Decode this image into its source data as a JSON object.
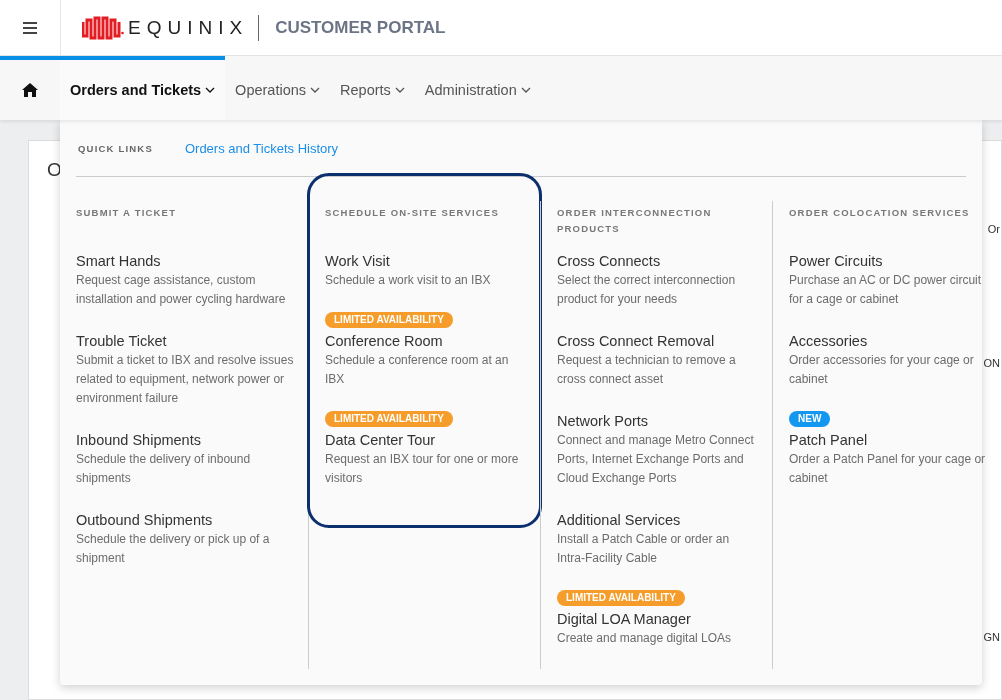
{
  "header": {
    "logo_text": "EQUINIX",
    "portal_title": "CUSTOMER PORTAL"
  },
  "nav": {
    "tabs": [
      {
        "label": "Orders and Tickets",
        "selected": true
      },
      {
        "label": "Operations",
        "selected": false
      },
      {
        "label": "Reports",
        "selected": false
      },
      {
        "label": "Administration",
        "selected": false
      }
    ]
  },
  "background": {
    "card_title": "O",
    "fragments": [
      "Or",
      "ON",
      "GN"
    ]
  },
  "menu": {
    "quick_links_label": "QUICK LINKS",
    "quick_links": [
      "Orders and Tickets History"
    ],
    "columns": [
      {
        "heading": "SUBMIT A TICKET",
        "highlighted": false,
        "items": [
          {
            "title": "Smart Hands",
            "description": "Request cage assistance, custom installation and power cycling hardware"
          },
          {
            "title": "Trouble Ticket",
            "description": "Submit a ticket to IBX and resolve issues related to equipment, network power or environment failure"
          },
          {
            "title": "Inbound Shipments",
            "description": "Schedule the delivery of inbound shipments"
          },
          {
            "title": "Outbound Shipments",
            "description": "Schedule the delivery or pick up of a shipment"
          }
        ]
      },
      {
        "heading": "SCHEDULE ON-SITE SERVICES",
        "highlighted": true,
        "items": [
          {
            "title": "Work Visit",
            "description": "Schedule a work visit to an IBX"
          },
          {
            "badge": {
              "text": "LIMITED AVAILABILITY",
              "kind": "limited"
            },
            "title": "Conference Room",
            "description": "Schedule a conference room at an IBX"
          },
          {
            "badge": {
              "text": "LIMITED AVAILABILITY",
              "kind": "limited"
            },
            "title": "Data Center Tour",
            "description": "Request an IBX tour for one or more visitors"
          }
        ]
      },
      {
        "heading": "ORDER INTERCONNECTION PRODUCTS",
        "highlighted": false,
        "items": [
          {
            "title": "Cross Connects",
            "description": "Select the correct interconnection product for your needs"
          },
          {
            "title": "Cross Connect Removal",
            "description": "Request a technician to remove a cross connect asset"
          },
          {
            "title": "Network Ports",
            "description": "Connect and manage Metro Connect Ports, Internet Exchange Ports and Cloud Exchange Ports"
          },
          {
            "title": "Additional Services",
            "description": "Install a Patch Cable or order an Intra-Facility Cable"
          },
          {
            "badge": {
              "text": "LIMITED AVAILABILITY",
              "kind": "limited"
            },
            "title": "Digital LOA Manager",
            "description": "Create and manage digital LOAs"
          }
        ]
      },
      {
        "heading": "ORDER COLOCATION SERVICES",
        "highlighted": false,
        "items": [
          {
            "title": "Power Circuits",
            "description": "Purchase an AC or DC power circuit for a cage or cabinet"
          },
          {
            "title": "Accessories",
            "description": "Order accessories for your cage or cabinet"
          },
          {
            "badge": {
              "text": "NEW",
              "kind": "new"
            },
            "title": "Patch Panel",
            "description": "Order a Patch Panel for your cage or cabinet"
          }
        ]
      }
    ]
  }
}
